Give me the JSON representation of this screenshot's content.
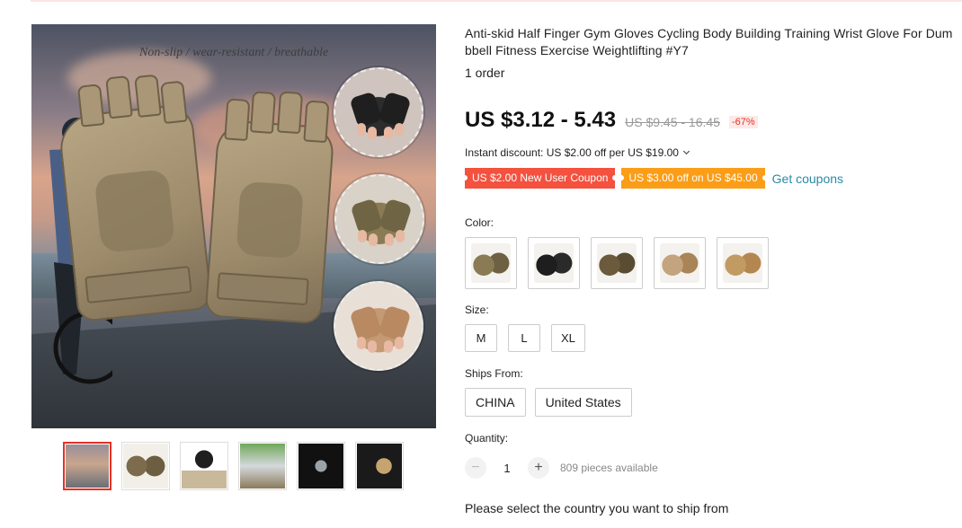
{
  "gallery": {
    "caption": "Non-slip / wear-resistant / breathable",
    "thumbnails": [
      "thumb-1",
      "thumb-2",
      "thumb-3",
      "thumb-4",
      "thumb-5",
      "thumb-6"
    ],
    "active_index": 0
  },
  "product": {
    "title": "Anti-skid Half Finger Gym Gloves Cycling Body Building Training Wrist Glove For Dumbbell Fitness Exercise Weightlifting #Y7",
    "orders": "1 order",
    "price": "US $3.12 - 5.43",
    "original_price": "US $9.45 - 16.45",
    "discount_pct": "-67%",
    "instant_discount": "Instant discount: US $2.00 off per US $19.00",
    "coupons": [
      {
        "label": "US $2.00 New User Coupon",
        "color": "#f4513e"
      },
      {
        "label": "US $3.00 off on US $45.00",
        "color": "#fb9d17"
      }
    ],
    "get_coupons": "Get coupons"
  },
  "options": {
    "color_label": "Color:",
    "color_swatches": [
      "camo-khaki",
      "black",
      "brown-camo",
      "desert-camo",
      "tan"
    ],
    "size_label": "Size:",
    "sizes": [
      "M",
      "L",
      "XL"
    ],
    "ships_from_label": "Ships From:",
    "ships_from": [
      "CHINA",
      "United States"
    ],
    "quantity_label": "Quantity:",
    "quantity_value": "1",
    "minus_symbol": "−",
    "plus_symbol": "+",
    "available": "809 pieces available",
    "ship_note": "Please select the country you want to ship from"
  }
}
